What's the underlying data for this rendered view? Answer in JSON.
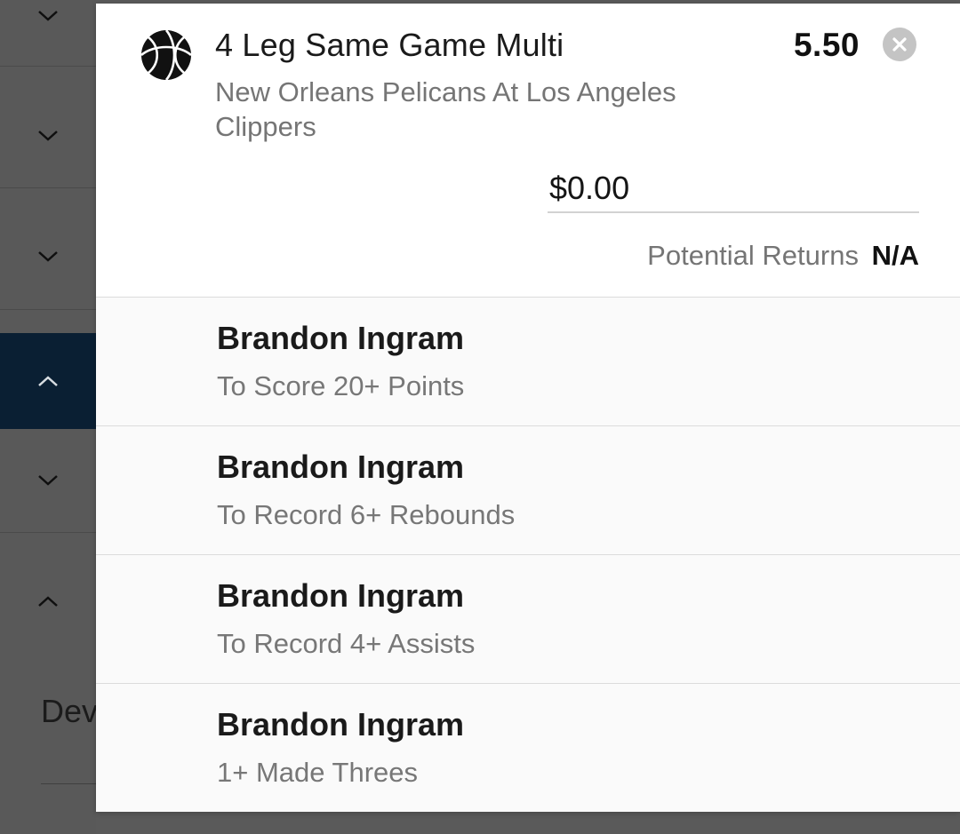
{
  "background": {
    "rows": [
      {
        "chevron": "chevron-down-icon",
        "state": "collapsed"
      },
      {
        "chevron": "chevron-down-icon",
        "state": "collapsed"
      },
      {
        "chevron": "chevron-down-icon",
        "state": "collapsed"
      },
      {
        "chevron": "chevron-up-icon",
        "state": "expanded-active"
      },
      {
        "chevron": "chevron-down-icon",
        "state": "collapsed"
      },
      {
        "chevron": "chevron-up-icon",
        "state": "expanded"
      }
    ],
    "partial_text": "Dev"
  },
  "bet": {
    "sport_icon": "basketball-icon",
    "title": "4 Leg Same Game Multi",
    "odds": "5.50",
    "match": "New Orleans Pelicans At Los Angeles Clippers",
    "stake_value": "$0.00",
    "potential_returns_label": "Potential Returns",
    "potential_returns_value": "N/A",
    "close_icon": "close-circle-icon"
  },
  "legs": [
    {
      "player": "Brandon Ingram",
      "market": "To Score 20+ Points"
    },
    {
      "player": "Brandon Ingram",
      "market": "To Record 6+ Rebounds"
    },
    {
      "player": "Brandon Ingram",
      "market": "To Record 4+ Assists"
    },
    {
      "player": "Brandon Ingram",
      "market": "1+ Made Threes"
    }
  ],
  "colors": {
    "overlay": "#5a5a5a",
    "active_row": "#0a1f33",
    "panel": "#ffffff",
    "leg_background": "#fafafa",
    "muted_text": "#757575"
  }
}
